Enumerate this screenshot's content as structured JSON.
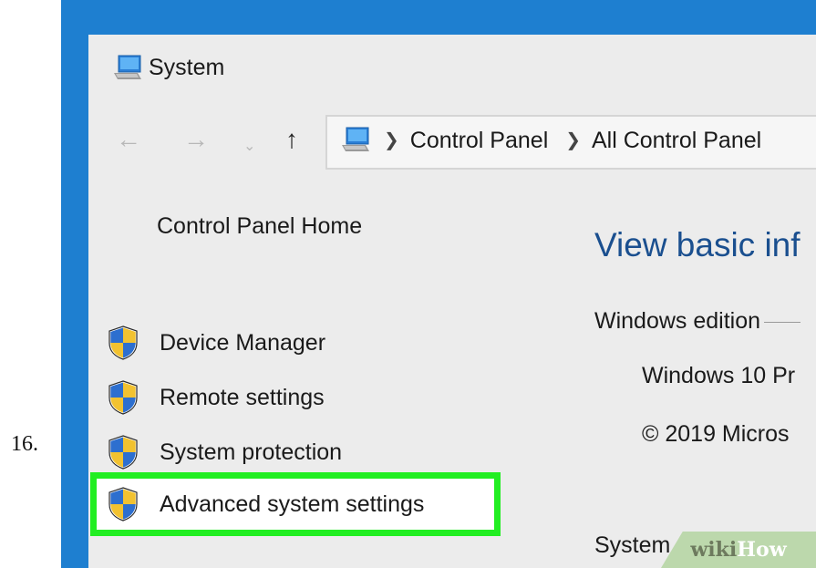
{
  "step": {
    "number": "16."
  },
  "window": {
    "title": "System",
    "icon": "computer-icon"
  },
  "nav": {
    "back_icon": "arrow-left-icon",
    "forward_icon": "arrow-right-icon",
    "recent_icon": "chevron-down-icon",
    "up_icon": "arrow-up-icon",
    "address": {
      "icon": "computer-icon",
      "crumbs": [
        "Control Panel",
        "All Control Panel"
      ]
    }
  },
  "sidebar": {
    "home": "Control Panel Home",
    "items": [
      {
        "label": "Device Manager",
        "icon": "shield-icon"
      },
      {
        "label": "Remote settings",
        "icon": "shield-icon"
      },
      {
        "label": "System protection",
        "icon": "shield-icon"
      },
      {
        "label": "Advanced system settings",
        "icon": "shield-icon",
        "highlighted": true
      }
    ]
  },
  "main": {
    "heading": "View basic inf",
    "edition_label": "Windows edition",
    "version": "Windows 10 Pr",
    "copyright": "© 2019 Micros",
    "system_label": "System"
  },
  "watermark": {
    "part1": "wiki",
    "part2": "How"
  },
  "colors": {
    "frame": "#1e7fd0",
    "window_bg": "#ececec",
    "heading": "#1a4f8f",
    "highlight": "#22ee22"
  }
}
